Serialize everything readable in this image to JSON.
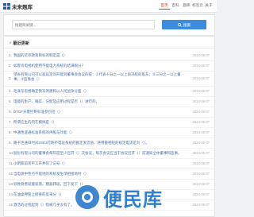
{
  "header": {
    "site_name": "未来题库",
    "nav": [
      "首页",
      "百科",
      "题库",
      "标签云",
      "关于"
    ],
    "active_nav": 0
  },
  "search": {
    "placeholder": "搜题目关键...",
    "button_label": "搜索"
  },
  "list": {
    "title": "最近更新",
    "items": [
      {
        "index": "1.",
        "text": "我国的货币政策目标的制定是（）",
        "date": "2024-05-07"
      },
      {
        "index": "2.",
        "text": "如客房电视机使用不能电力系统的结满限分？",
        "date": "2024-05-07"
      },
      {
        "index": "3.",
        "text": "望省有限公司可以就设定问开能到董事会会议的提：①代表十分之一以上表决权的股东；②三分之一以上董事；③监事会（）",
        "date": "2024-05-07"
      },
      {
        "index": "4.",
        "text": "毛泽东思想确定我军的建和以人民战争分面（）",
        "date": "2024-05-07"
      },
      {
        "index": "5.",
        "text": "电能的生产、确实、分配及应用过程是否（）进行的。",
        "date": "2024-05-07"
      },
      {
        "index": "6.",
        "text": "DTDF天量控制标准参包括（）",
        "date": "2024-05-07"
      },
      {
        "index": "7.",
        "text": "所谓应生的内在模拟是（）",
        "date": "2024-05-07"
      },
      {
        "index": "8.",
        "text": "中通性逻通标准系统的供股与计能（）",
        "date": "2024-05-07"
      },
      {
        "index": "9.",
        "text": "路于连通日时间2SE3行期不电设系统的额定发流值，将用额相短的规定电流是为（）。",
        "date": "2024-05-07"
      },
      {
        "index": "10.",
        "text": "股份有限公司的董事会每年度至少召开（）次会议，每次会议应当于会议召开（）前通知全体董事和监事。",
        "date": "2024-05-07"
      },
      {
        "index": "11.",
        "text": "小明家前装平工开并装了记号（）",
        "date": "2024-05-07"
      },
      {
        "index": "12.",
        "text": "当电源中性点不能地的系统发生单相接地时（）",
        "date": "2024-05-07"
      },
      {
        "index": "13.",
        "text": "导致骨者就能就落、糖器转斑，回下发下（）",
        "date": "2024-05-07"
      },
      {
        "index": "14.",
        "text": "在油桌押管上接要的反采分（）",
        "date": "2024-05-07"
      },
      {
        "index": "15.",
        "text": "激活的过程起到（）指被几乎没有了。",
        "date": "2024-05-07"
      }
    ]
  },
  "watermark": {
    "text": "便民库",
    "logo_icon": "circle-logo-icon"
  },
  "colors": {
    "accent_red": "#e0322c",
    "brand_blue": "#3c8dde",
    "link_blue": "#4a6fa5"
  }
}
